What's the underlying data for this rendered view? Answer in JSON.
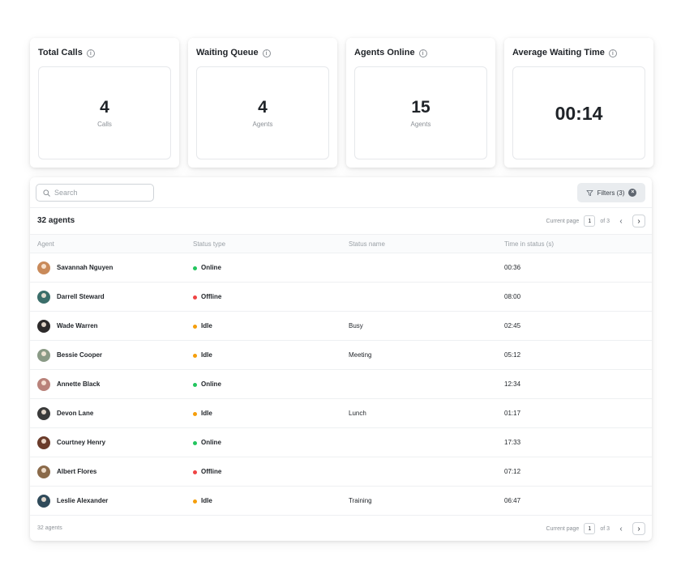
{
  "stats": [
    {
      "title": "Total Calls",
      "value": "4",
      "unit": "Calls"
    },
    {
      "title": "Waiting Queue",
      "value": "4",
      "unit": "Agents"
    },
    {
      "title": "Agents Online",
      "value": "15",
      "unit": "Agents"
    },
    {
      "title": "Average Waiting Time",
      "value": "00:14",
      "unit": ""
    }
  ],
  "toolbar": {
    "search_placeholder": "Search",
    "filters_label": "Filters (3)"
  },
  "list": {
    "count_title": "32 agents",
    "footer_count": "32 agents"
  },
  "pager": {
    "label": "Current page",
    "page": "1",
    "of": "of 3"
  },
  "columns": [
    "Agent",
    "Status type",
    "Status name",
    "Time in status (s)"
  ],
  "status_colors": {
    "Online": "#22c55e",
    "Offline": "#ef4444",
    "Idle": "#f59e0b"
  },
  "rows": [
    {
      "name": "Savannah Nguyen",
      "status": "Online",
      "status_name": "",
      "time": "00:36",
      "avatar_color": "#c98a5a"
    },
    {
      "name": "Darrell Steward",
      "status": "Offline",
      "status_name": "",
      "time": "08:00",
      "avatar_color": "#3b6e6a"
    },
    {
      "name": "Wade Warren",
      "status": "Idle",
      "status_name": "Busy",
      "time": "02:45",
      "avatar_color": "#2d2a2a"
    },
    {
      "name": "Bessie Cooper",
      "status": "Idle",
      "status_name": "Meeting",
      "time": "05:12",
      "avatar_color": "#8a9a86"
    },
    {
      "name": "Annette Black",
      "status": "Online",
      "status_name": "",
      "time": "12:34",
      "avatar_color": "#b9827a"
    },
    {
      "name": "Devon Lane",
      "status": "Idle",
      "status_name": "Lunch",
      "time": "01:17",
      "avatar_color": "#3a3a3a"
    },
    {
      "name": "Courtney Henry",
      "status": "Online",
      "status_name": "",
      "time": "17:33",
      "avatar_color": "#6a3b2a"
    },
    {
      "name": "Albert Flores",
      "status": "Offline",
      "status_name": "",
      "time": "07:12",
      "avatar_color": "#8a6a4a"
    },
    {
      "name": "Leslie Alexander",
      "status": "Idle",
      "status_name": "Training",
      "time": "06:47",
      "avatar_color": "#2f4a5a"
    }
  ]
}
